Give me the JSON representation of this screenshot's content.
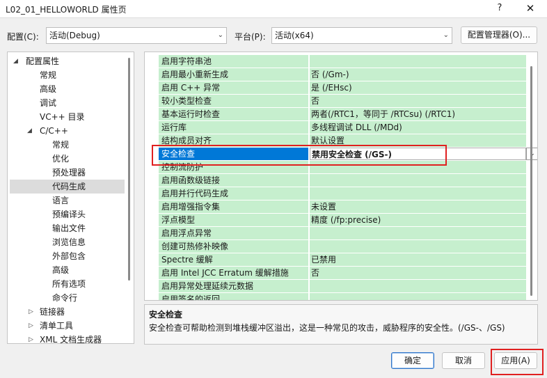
{
  "window": {
    "title": "L02_01_HELLOWORLD 属性页",
    "help": "?",
    "close": "✕"
  },
  "config": {
    "config_label": "配置(C):",
    "config_value": "活动(Debug)",
    "platform_label": "平台(P):",
    "platform_value": "活动(x64)",
    "manager_button": "配置管理器(O)..."
  },
  "tree": {
    "root": "配置属性",
    "items": [
      "常规",
      "高级",
      "调试",
      "VC++ 目录"
    ],
    "cpp": "C/C++",
    "cpp_items": [
      "常规",
      "优化",
      "预处理器",
      "代码生成",
      "语言",
      "预编译头",
      "输出文件",
      "浏览信息",
      "外部包含",
      "高级",
      "所有选项",
      "命令行"
    ],
    "collapsed": [
      "链接器",
      "清单工具",
      "XML 文档生成器"
    ]
  },
  "properties": [
    {
      "name": "启用字符串池",
      "value": ""
    },
    {
      "name": "启用最小重新生成",
      "value": "否 (/Gm-)"
    },
    {
      "name": "启用 C++ 异常",
      "value": "是 (/EHsc)"
    },
    {
      "name": "较小类型检查",
      "value": "否"
    },
    {
      "name": "基本运行时检查",
      "value": "两者(/RTC1，等同于 /RTCsu) (/RTC1)"
    },
    {
      "name": "运行库",
      "value": "多线程调试 DLL (/MDd)"
    },
    {
      "name": "结构成员对齐",
      "value": "默认设置"
    },
    {
      "name": "安全检查",
      "value": "禁用安全检查 (/GS-)"
    },
    {
      "name": "控制流防护",
      "value": ""
    },
    {
      "name": "启用函数级链接",
      "value": ""
    },
    {
      "name": "启用并行代码生成",
      "value": ""
    },
    {
      "name": "启用增强指令集",
      "value": "未设置"
    },
    {
      "name": "浮点模型",
      "value": "精度 (/fp:precise)"
    },
    {
      "name": "启用浮点异常",
      "value": ""
    },
    {
      "name": "创建可热修补映像",
      "value": ""
    },
    {
      "name": "Spectre 缓解",
      "value": "已禁用"
    },
    {
      "name": "启用 Intel JCC Erratum 缓解措施",
      "value": "否"
    },
    {
      "name": "启用异常处理延续元数据",
      "value": ""
    },
    {
      "name": "启用签名的返回",
      "value": ""
    }
  ],
  "description": {
    "title": "安全检查",
    "text": "安全检查可帮助检测到堆栈缓冲区溢出，这是一种常见的攻击，威胁程序的安全性。(/GS-、/GS)"
  },
  "buttons": {
    "ok": "确定",
    "cancel": "取消",
    "apply": "应用(A)"
  },
  "colors": {
    "property_bg": "#c6efce",
    "selection": "#0078d7",
    "highlight_box": "#e02020"
  }
}
